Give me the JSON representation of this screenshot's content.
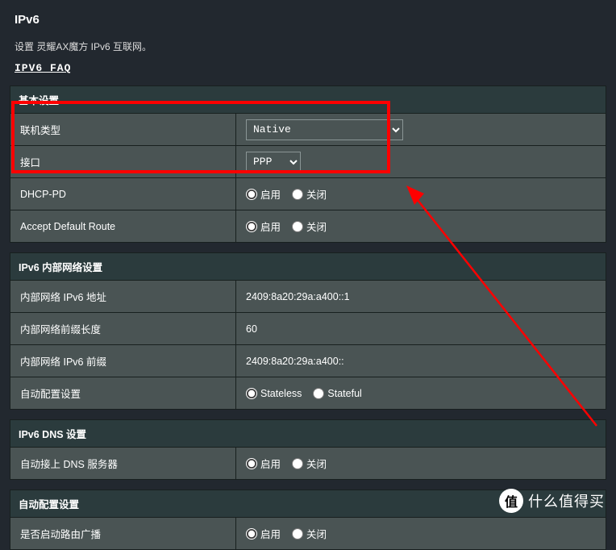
{
  "page": {
    "title": "IPv6",
    "description": "设置 灵耀AX魔方 IPv6 互联网。",
    "faq_link": "IPV6 FAQ"
  },
  "sections": {
    "basic": {
      "header": "基本设置",
      "rows": {
        "conn_type": {
          "label": "联机类型",
          "value": "Native",
          "options": [
            "Native"
          ]
        },
        "interface": {
          "label": "接口",
          "value": "PPP",
          "options": [
            "PPP"
          ]
        },
        "dhcp_pd": {
          "label": "DHCP-PD",
          "opt_on": "启用",
          "opt_off": "关闭",
          "selected": "on"
        },
        "accept_default_route": {
          "label": "Accept Default Route",
          "opt_on": "启用",
          "opt_off": "关闭",
          "selected": "on"
        }
      }
    },
    "lan": {
      "header": "IPv6 内部网络设置",
      "rows": {
        "lan_addr": {
          "label": "内部网络 IPv6 地址",
          "value": "2409:8a20:29a:a400::1"
        },
        "prefix_len": {
          "label": "内部网络前缀长度",
          "value": "60"
        },
        "lan_prefix": {
          "label": "内部网络 IPv6 前缀",
          "value": "2409:8a20:29a:a400::"
        },
        "autoconf": {
          "label": "自动配置设置",
          "opt_a": "Stateless",
          "opt_b": "Stateful",
          "selected": "a"
        }
      }
    },
    "dns": {
      "header": "IPv6 DNS 设置",
      "rows": {
        "auto_dns": {
          "label": "自动接上 DNS 服务器",
          "opt_on": "启用",
          "opt_off": "关闭",
          "selected": "on"
        }
      }
    },
    "ra": {
      "header": "自动配置设置",
      "rows": {
        "router_adv": {
          "label": "是否启动路由广播",
          "opt_on": "启用",
          "opt_off": "关闭",
          "selected": "on"
        }
      }
    }
  },
  "watermark": {
    "badge": "值",
    "text": "什么值得买"
  }
}
